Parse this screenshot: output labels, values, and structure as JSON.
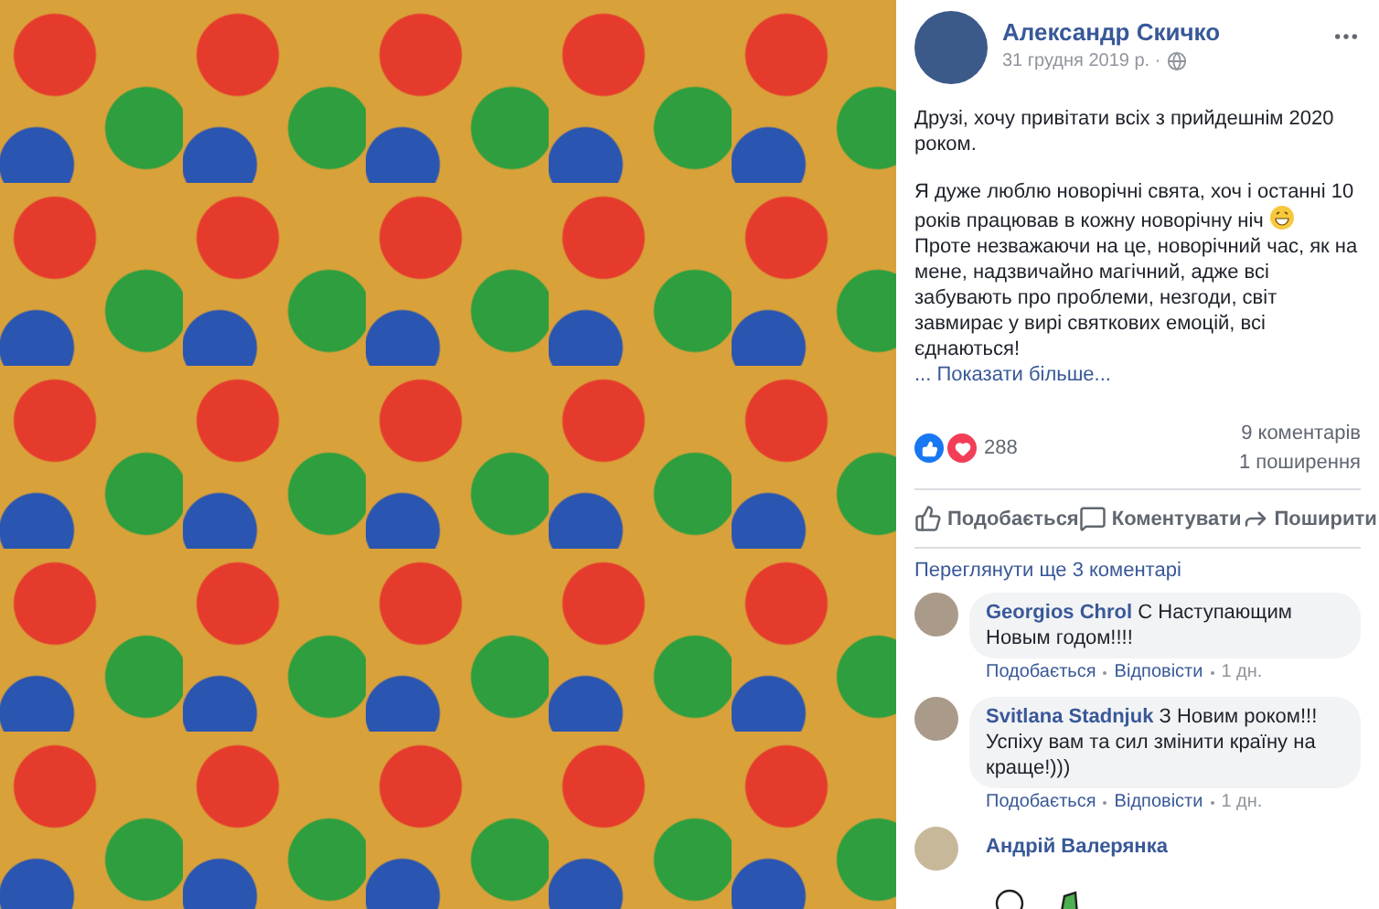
{
  "post": {
    "author": "Александр Скичко",
    "date": "31 грудня 2019 р. ·",
    "blocks": [
      {
        "kind": "paragraph",
        "text": "Друзі, хочу привітати всіх з прийдешнім 2020 роком.",
        "emoji": false
      },
      {
        "kind": "paragraph",
        "text": "Я дуже люблю новорічні свята, хоч і останні 10 років працював в кожну новорічну ніч",
        "emoji": true
      },
      {
        "kind": "continuation",
        "text": "Проте незважаючи на це, новорічний час, як на мене, надзвичайно магічний, адже всі забувають про проблеми, незгоди, світ завмирає у вирі святкових емоцій, всі єднаються!",
        "emoji": false
      }
    ],
    "see_more": "... Показати більше...",
    "reactions_count": "288",
    "comments_count": "9 коментарів",
    "shares_count": "1 поширення",
    "actions": [
      {
        "kind": "like",
        "label": "Подобається"
      },
      {
        "kind": "comment",
        "label": "Коментувати"
      },
      {
        "kind": "share",
        "label": "Поширити"
      }
    ]
  },
  "comments": {
    "view_more": "Переглянути ще 3 коментарі",
    "items": [
      {
        "kind": "text",
        "author": "Georgios Chrol",
        "text": "С Наступающим Новым годом!!!!",
        "like": "Подобається",
        "reply": "Відповісти",
        "time": "1 дн."
      },
      {
        "kind": "text",
        "author": "Svitlana Stadnjuk",
        "text": "З Новим роком!!! Успіху вам та сил змінити країну на краще!)))",
        "like": "Подобається",
        "reply": "Відповісти",
        "time": "1 дн."
      },
      {
        "kind": "sticker",
        "author": "Андрій Валерянка"
      }
    ]
  }
}
